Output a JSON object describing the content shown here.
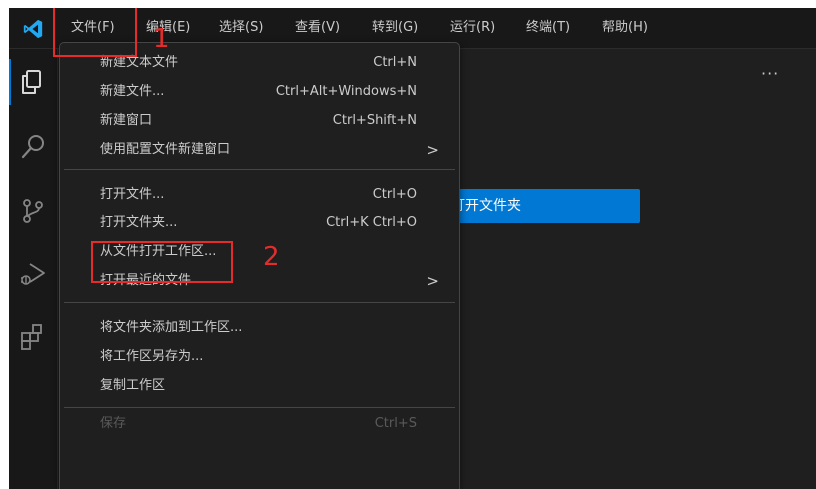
{
  "menubar": {
    "items": [
      "文件(F)",
      "编辑(E)",
      "选择(S)",
      "查看(V)",
      "转到(G)",
      "运行(R)",
      "终端(T)",
      "帮助(H)"
    ]
  },
  "activity_bar": {
    "icons": [
      "explorer-icon",
      "search-icon",
      "source-control-icon",
      "run-debug-icon",
      "extensions-icon"
    ]
  },
  "editor": {
    "more_actions": "···",
    "open_folder_button_label": "打开文件夹"
  },
  "file_menu": {
    "items": [
      {
        "label": "新建文本文件",
        "shortcut": "Ctrl+N"
      },
      {
        "label": "新建文件...",
        "shortcut": "Ctrl+Alt+Windows+N"
      },
      {
        "label": "新建窗口",
        "shortcut": "Ctrl+Shift+N"
      },
      {
        "label": "使用配置文件新建窗口",
        "submenu": ">"
      },
      {
        "label": "打开文件...",
        "shortcut": "Ctrl+O"
      },
      {
        "label": "打开文件夹...",
        "shortcut": "Ctrl+K Ctrl+O"
      },
      {
        "label": "从文件打开工作区..."
      },
      {
        "label": "打开最近的文件",
        "submenu": ">"
      },
      {
        "label": "将文件夹添加到工作区..."
      },
      {
        "label": "将工作区另存为..."
      },
      {
        "label": "复制工作区"
      },
      {
        "label": "保存",
        "shortcut": "Ctrl+S"
      }
    ]
  },
  "annotations": {
    "step1": "1",
    "step2": "2",
    "color": "#e62b2b"
  },
  "colors": {
    "accent": "#0078d4",
    "background": "#1f1f1f",
    "menubar_background": "#181818",
    "annotation": "#e62b2b"
  }
}
